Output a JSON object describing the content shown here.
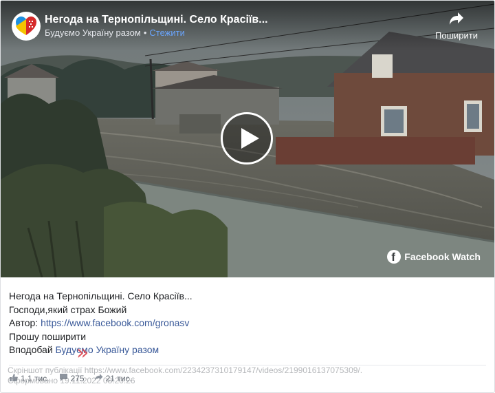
{
  "video": {
    "title": "Негода на Тернопільщині. Село Красіїв...",
    "page_name": "Будуємо Україну разом",
    "separator": "•",
    "follow_label": "Стежити",
    "share_label": "Поширити",
    "watch_label": "Facebook Watch",
    "icons": {
      "avatar": "ukraine-heart-avatar-icon",
      "share": "share-arrow-icon",
      "play": "play-icon",
      "facebook": "facebook-logo-icon"
    }
  },
  "post": {
    "line1": "Негода на Тернопільщині. Село Красіїв...",
    "line2": "Господи,який страх Божий",
    "author_prefix": "Автор: ",
    "author_link": "https://www.facebook.com/gronasv",
    "line4": "Прошу поширити",
    "like_prefix": "Вподобай ",
    "like_link": "Будуємо Україну разом"
  },
  "stats": {
    "likes": "1,1 тис.",
    "comments": "275",
    "shares": "21 тис."
  },
  "watermark": {
    "line1": "Скріншот публікації https://www.facebook.com/2234237310179147/videos/2199016137075309/.",
    "line2": "Сформовано 19.11.2022 08:20:26"
  },
  "colors": {
    "link": "#385898",
    "follow": "#6aa6ff",
    "text": "#1c1e21",
    "muted": "#606770"
  }
}
